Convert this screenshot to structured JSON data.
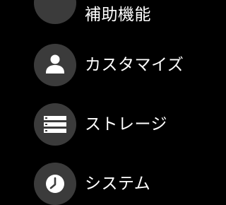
{
  "settings_menu": {
    "items": [
      {
        "label": "補助機能",
        "icon": "accessibility-icon"
      },
      {
        "label": "カスタマイズ",
        "icon": "person-icon"
      },
      {
        "label": "ストレージ",
        "icon": "storage-icon"
      },
      {
        "label": "システム",
        "icon": "clock-icon"
      }
    ]
  },
  "colors": {
    "background": "#000000",
    "icon_circle": "#3b3b3b",
    "text": "#ffffff"
  }
}
